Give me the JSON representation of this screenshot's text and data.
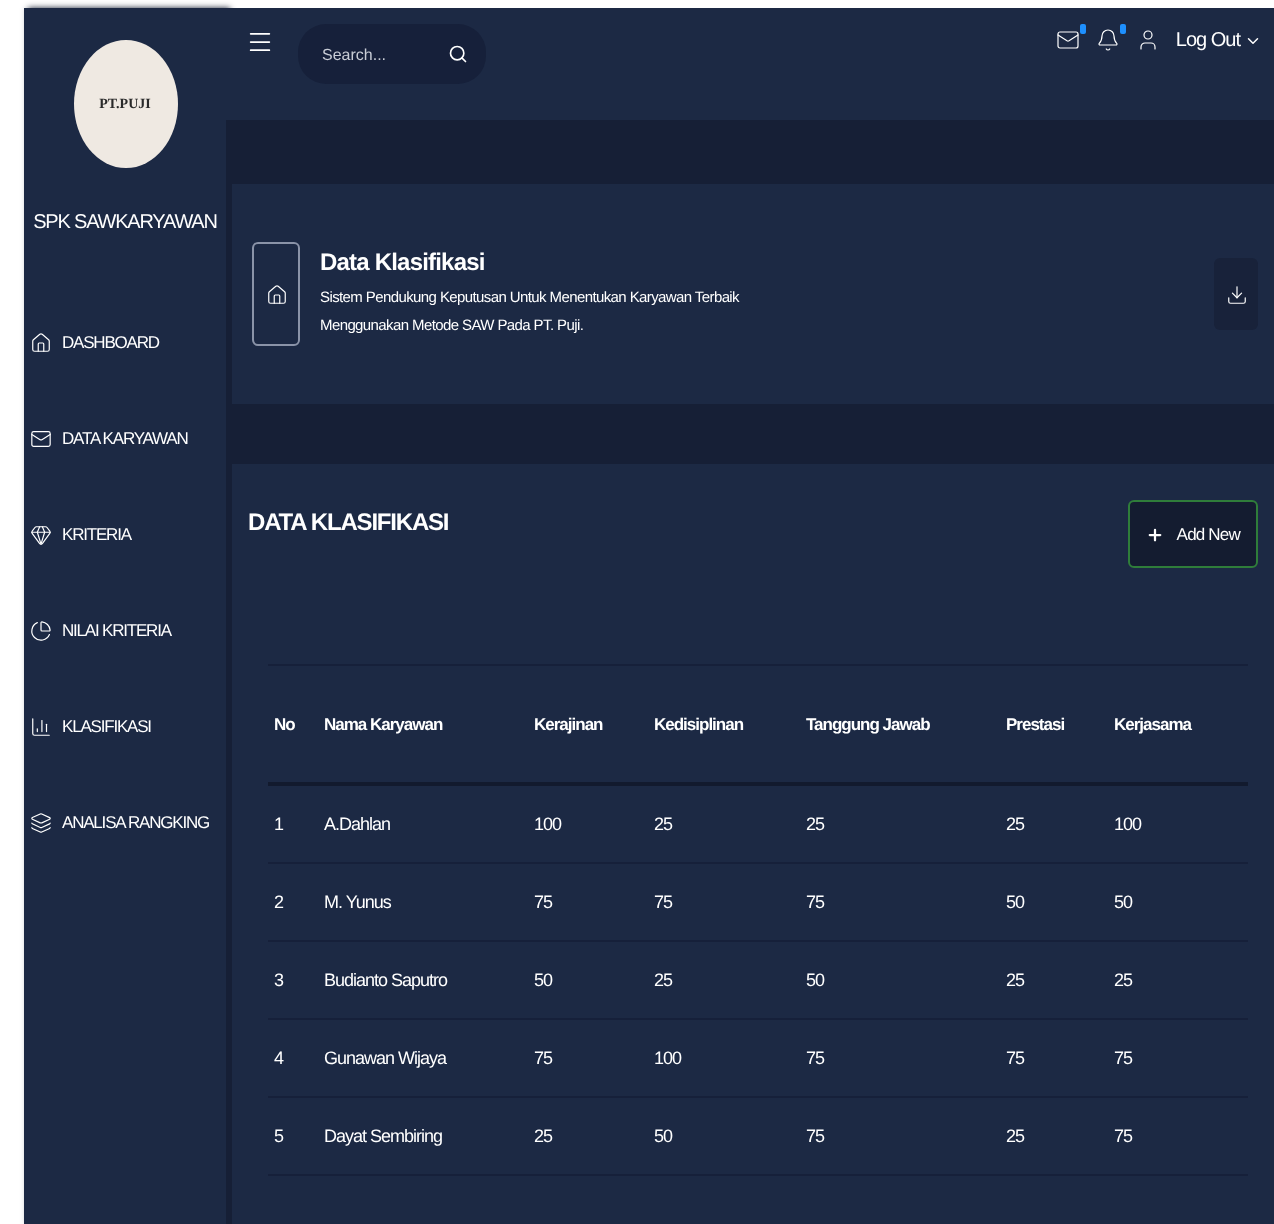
{
  "sidebar": {
    "logo": "PT.PUJI",
    "app_name": "SPK SAWKARYAWAN",
    "items": [
      {
        "label": "DASHBOARD"
      },
      {
        "label": "DATA KARYAWAN"
      },
      {
        "label": "KRITERIA"
      },
      {
        "label": "NILAI KRITERIA"
      },
      {
        "label": "KLASIFIKASI"
      },
      {
        "label": "ANALISA RANGKING"
      }
    ]
  },
  "topbar": {
    "search": {
      "placeholder": "Search..."
    },
    "user": "Log Out"
  },
  "page_header": {
    "title": "Data Klasifikasi",
    "subtitle": "Sistem Pendukung Keputusan Untuk Menentukan Karyawan Terbaik Menggunakan Metode SAW Pada PT. Puji."
  },
  "section": {
    "title": "DATA KLASIFIKASI",
    "add_button": "Add New"
  },
  "table": {
    "columns": [
      "No",
      "Nama Karyawan",
      "Kerajinan",
      "Kedisiplinan",
      "Tanggung Jawab",
      "Prestasi",
      "Kerjasama"
    ],
    "rows": [
      [
        "1",
        "A.Dahlan",
        "100",
        "25",
        "25",
        "25",
        "100"
      ],
      [
        "2",
        "M. Yunus",
        "75",
        "75",
        "75",
        "50",
        "50"
      ],
      [
        "3",
        "Budianto Saputro",
        "50",
        "25",
        "50",
        "25",
        "25"
      ],
      [
        "4",
        "Gunawan Wijaya",
        "75",
        "100",
        "75",
        "75",
        "75"
      ],
      [
        "5",
        "Dayat Sembiring",
        "25",
        "50",
        "75",
        "25",
        "75"
      ]
    ]
  }
}
